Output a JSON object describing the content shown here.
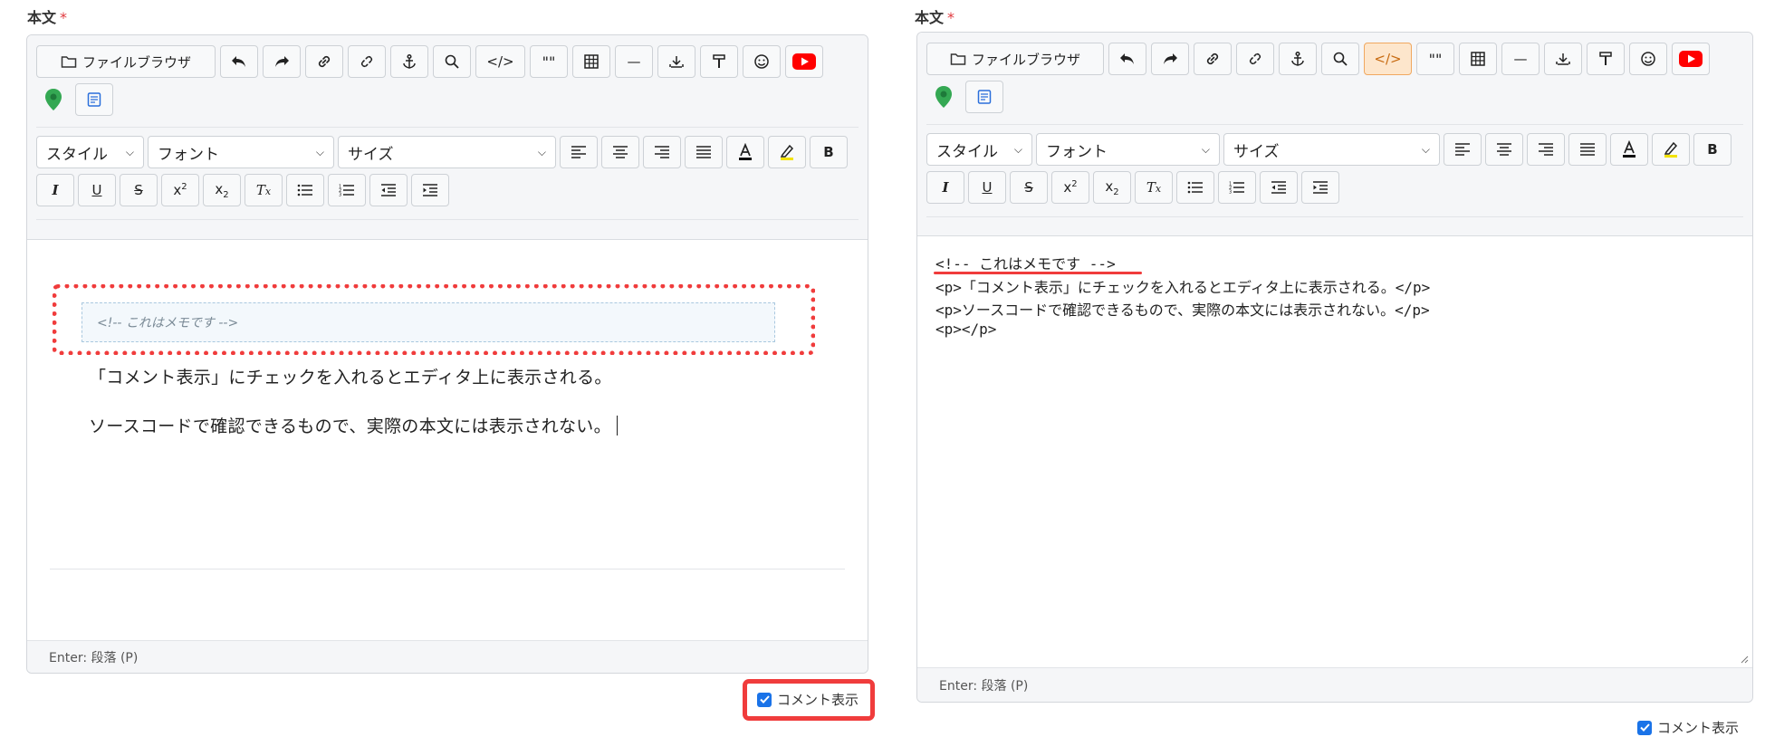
{
  "left": {
    "label": "本文",
    "required_mark": "*",
    "toolbar": {
      "file_browser": "ファイルブラウザ",
      "style": "スタイル",
      "font": "フォント",
      "size": "サイズ",
      "bold": "B"
    },
    "comment_block": "<!-- これはメモです -->",
    "lines": [
      "「コメント表示」にチェックを入れるとエディタ上に表示される。",
      "ソースコードで確認できるもので、実際の本文には表示されない。"
    ],
    "status": "Enter: 段落 (P)",
    "comment_toggle": "コメント表示"
  },
  "right": {
    "label": "本文",
    "required_mark": "*",
    "toolbar": {
      "file_browser": "ファイルブラウザ",
      "style": "スタイル",
      "font": "フォント",
      "size": "サイズ",
      "bold": "B"
    },
    "source_lines": [
      "<!-- これはメモです -->",
      "<p>「コメント表示」にチェックを入れるとエディタ上に表示される。</p>",
      "<p>ソースコードで確認できるもので、実際の本文には表示されない。</p>",
      "<p></p>"
    ],
    "status": "Enter: 段落 (P)",
    "comment_toggle": "コメント表示"
  },
  "colors": {
    "highlight_red": "#f03c3c",
    "source_active": "#fde6cc",
    "checkbox_blue": "#1a73e8",
    "youtube_red": "#ff0000",
    "map_green": "#34a853"
  }
}
